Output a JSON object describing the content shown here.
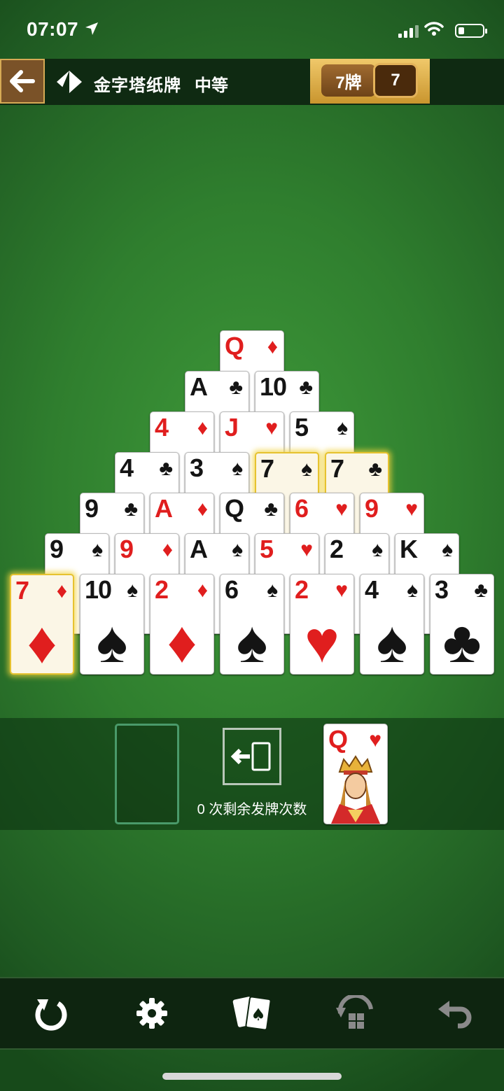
{
  "status": {
    "time": "07:07"
  },
  "header": {
    "title": "金字塔纸牌",
    "difficulty": "中等",
    "mode_label": "7牌",
    "mode_value": "7"
  },
  "pyramid": [
    [
      {
        "rank": "Q",
        "suit": "♦",
        "color": "red"
      }
    ],
    [
      {
        "rank": "A",
        "suit": "♣",
        "color": "black"
      },
      {
        "rank": "10",
        "suit": "♣",
        "color": "black"
      }
    ],
    [
      {
        "rank": "4",
        "suit": "♦",
        "color": "red"
      },
      {
        "rank": "J",
        "suit": "♥",
        "color": "red"
      },
      {
        "rank": "5",
        "suit": "♠",
        "color": "black"
      }
    ],
    [
      {
        "rank": "4",
        "suit": "♣",
        "color": "black"
      },
      {
        "rank": "3",
        "suit": "♠",
        "color": "black"
      },
      {
        "rank": "7",
        "suit": "♠",
        "color": "black",
        "highlight": true
      },
      {
        "rank": "7",
        "suit": "♣",
        "color": "black",
        "highlight": true
      }
    ],
    [
      {
        "rank": "9",
        "suit": "♣",
        "color": "black"
      },
      {
        "rank": "A",
        "suit": "♦",
        "color": "red"
      },
      {
        "rank": "Q",
        "suit": "♣",
        "color": "black"
      },
      {
        "rank": "6",
        "suit": "♥",
        "color": "red"
      },
      {
        "rank": "9",
        "suit": "♥",
        "color": "red"
      }
    ],
    [
      {
        "rank": "9",
        "suit": "♠",
        "color": "black"
      },
      {
        "rank": "9",
        "suit": "♦",
        "color": "red"
      },
      {
        "rank": "A",
        "suit": "♠",
        "color": "black"
      },
      {
        "rank": "5",
        "suit": "♥",
        "color": "red"
      },
      {
        "rank": "2",
        "suit": "♠",
        "color": "black"
      },
      {
        "rank": "K",
        "suit": "♠",
        "color": "black"
      }
    ],
    [
      {
        "rank": "7",
        "suit": "♦",
        "color": "red",
        "highlight": true
      },
      {
        "rank": "10",
        "suit": "♠",
        "color": "black"
      },
      {
        "rank": "2",
        "suit": "♦",
        "color": "red"
      },
      {
        "rank": "6",
        "suit": "♠",
        "color": "black"
      },
      {
        "rank": "2",
        "suit": "♥",
        "color": "red"
      },
      {
        "rank": "4",
        "suit": "♠",
        "color": "black"
      },
      {
        "rank": "3",
        "suit": "♣",
        "color": "black"
      }
    ]
  ],
  "stock": {
    "redeals_text": "0 次剩余发牌次数"
  },
  "waste": {
    "rank": "Q",
    "suit": "♥",
    "color": "red"
  },
  "toolbar": {
    "items": [
      "restart-icon",
      "settings-icon",
      "new-deal-icon",
      "hint-icon",
      "undo-icon"
    ]
  }
}
